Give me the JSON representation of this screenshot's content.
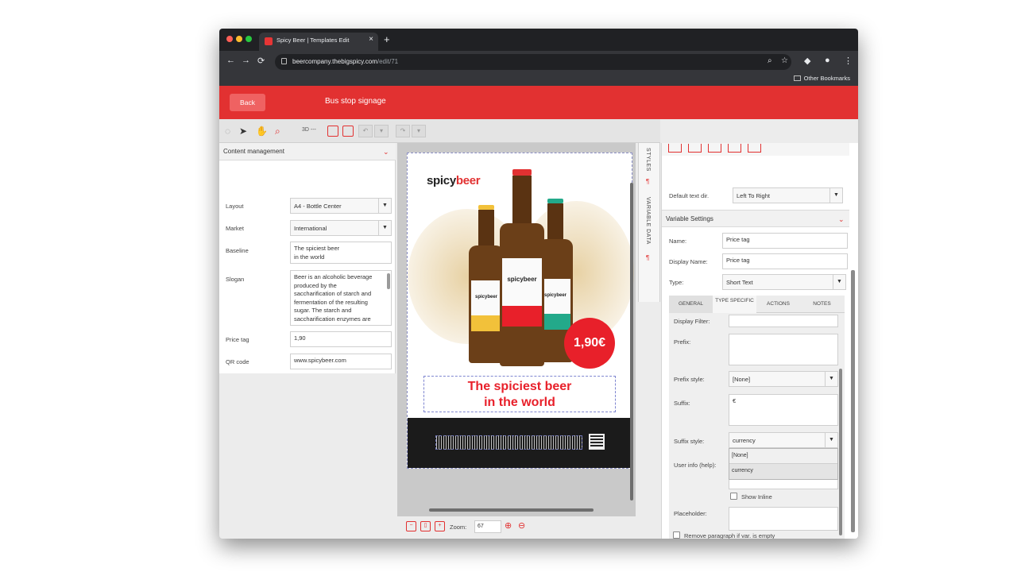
{
  "browser": {
    "tab_title": "Spicy Beer | Templates Edit",
    "url_host": "beercompany.thebigspicy.com",
    "url_path": "/edit/71",
    "bookmarks_label": "Other Bookmarks"
  },
  "app": {
    "back_label": "Back",
    "title": "Bus stop signage"
  },
  "toolbar": {
    "mode_3d": "3D ---"
  },
  "content_panel": {
    "title": "Content management",
    "fields": [
      {
        "label": "Layout",
        "value": "A4 - Bottle Center"
      },
      {
        "label": "Market",
        "value": "International"
      },
      {
        "label": "Baseline",
        "value": "The spiciest beer\nin the world"
      },
      {
        "label": "Slogan",
        "value": "Beer is an alcoholic beverage\nproduced by the\nsaccharification of starch and\nfermentation of the resulting\nsugar. The starch and\nsaccharification enzymes are"
      },
      {
        "label": "Price tag",
        "value": "1,90"
      },
      {
        "label": "QR code",
        "value": "www.spicybeer.com"
      }
    ]
  },
  "preview": {
    "logo_a": "spicy",
    "logo_b": "beer",
    "price": "1,90€",
    "slogan_line1": "The spiciest beer",
    "slogan_line2": "in the world",
    "bottle_logo": "spicybeer"
  },
  "zoom": {
    "label": "Zoom:",
    "value": "67"
  },
  "vertical_tabs": {
    "styles": "STYLES",
    "variable_data": "VARIABLE DATA"
  },
  "settings_panel": {
    "default_text_dir_label": "Default text dir.",
    "default_text_dir_value": "Left To Right",
    "section_title": "Variable Settings",
    "name_label": "Name:",
    "name_value": "Price tag",
    "display_name_label": "Display Name:",
    "display_name_value": "Price tag",
    "type_label": "Type:",
    "type_value": "Short Text",
    "tabs": [
      "GENERAL",
      "TYPE SPECIFIC",
      "ACTIONS",
      "NOTES"
    ],
    "display_filter_label": "Display Filter:",
    "prefix_label": "Prefix:",
    "prefix_style_label": "Prefix style:",
    "prefix_style_value": "[None]",
    "suffix_label": "Suffix:",
    "suffix_value": "€",
    "suffix_style_label": "Suffix style:",
    "suffix_style_value": "currency",
    "suffix_style_options": [
      "[None]",
      "currency"
    ],
    "user_info_label": "User info (help):",
    "show_inline_label": "Show Inline",
    "placeholder_label": "Placeholder:",
    "remove_paragraph_label": "Remove paragraph if var. is empty"
  },
  "colors": {
    "brand_red": "#e23131",
    "price_red": "#e8202a"
  }
}
